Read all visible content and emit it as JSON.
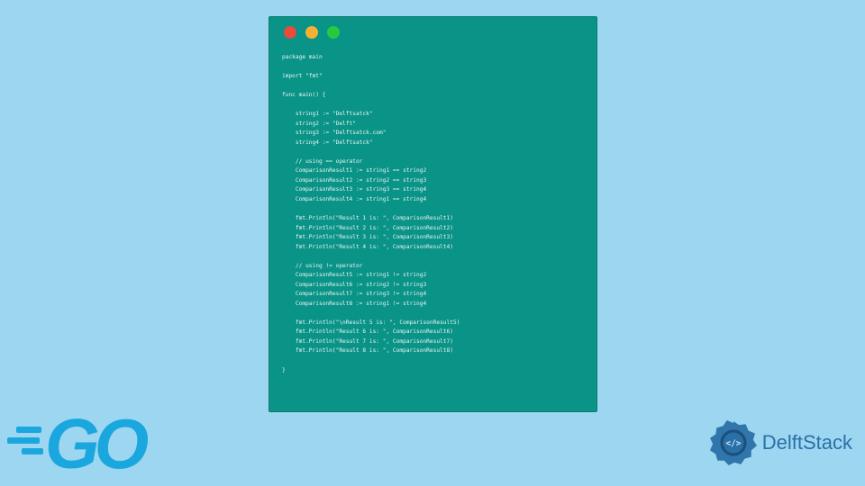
{
  "code_window": {
    "dots": [
      "red",
      "yellow",
      "green"
    ],
    "lines": [
      "package main",
      "",
      "import \"fmt\"",
      "",
      "func main() {",
      "",
      "    string1 := \"Delftsatck\"",
      "    string2 := \"Delft\"",
      "    string3 := \"Delftsatck.com\"",
      "    string4 := \"Delftsatck\"",
      "",
      "    // using == operator",
      "    ComparisonResult1 := string1 == string2",
      "    ComparisonResult2 := string2 == string3",
      "    ComparisonResult3 := string3 == string4",
      "    ComparisonResult4 := string1 == string4",
      "",
      "    fmt.Println(\"Result 1 is: \", ComparisonResult1)",
      "    fmt.Println(\"Result 2 is: \", ComparisonResult2)",
      "    fmt.Println(\"Result 3 is: \", ComparisonResult3)",
      "    fmt.Println(\"Result 4 is: \", ComparisonResult4)",
      "",
      "    // using != operator",
      "    ComparisonResult5 := string1 != string2",
      "    ComparisonResult6 := string2 != string3",
      "    ComparisonResult7 := string3 != string4",
      "    ComparisonResult8 := string1 != string4",
      "",
      "    fmt.Println(\"\\nResult 5 is: \", ComparisonResult5)",
      "    fmt.Println(\"Result 6 is: \", ComparisonResult6)",
      "    fmt.Println(\"Result 7 is: \", ComparisonResult7)",
      "    fmt.Println(\"Result 8 is: \", ComparisonResult8)",
      "",
      "}"
    ]
  },
  "go_logo": {
    "text": "GO"
  },
  "delft_logo": {
    "text": "DelftStack",
    "code_tag": "</>"
  }
}
